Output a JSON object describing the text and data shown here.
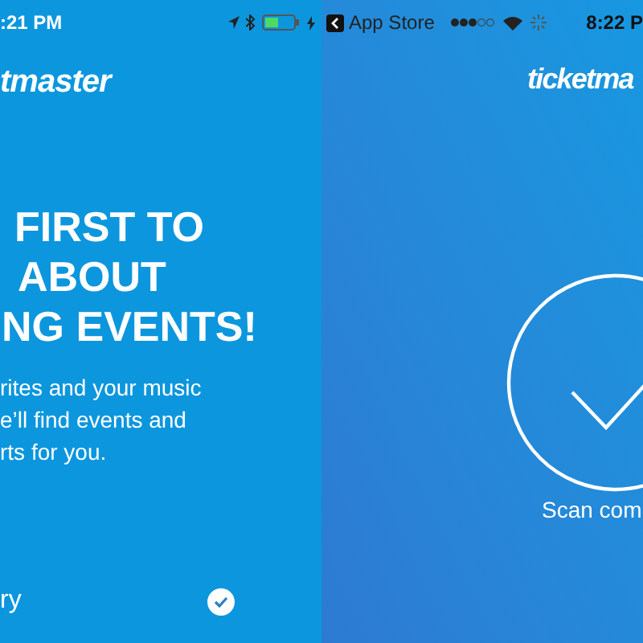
{
  "status_bar": {
    "time_left": ":21 PM",
    "back_app": "App Store",
    "time_right": "8:22 P"
  },
  "screens": [
    {
      "kind": "onboarding",
      "logo": "tmaster",
      "headline": [
        "FIRST TO",
        "ABOUT",
        "NG EVENTS!"
      ],
      "body": [
        "rites and your music",
        "e’ll find events and",
        "rts for you."
      ],
      "option": {
        "label": "ry",
        "checked": true
      }
    },
    {
      "kind": "scan",
      "logo": "ticketma",
      "message": "Scan com"
    }
  ]
}
